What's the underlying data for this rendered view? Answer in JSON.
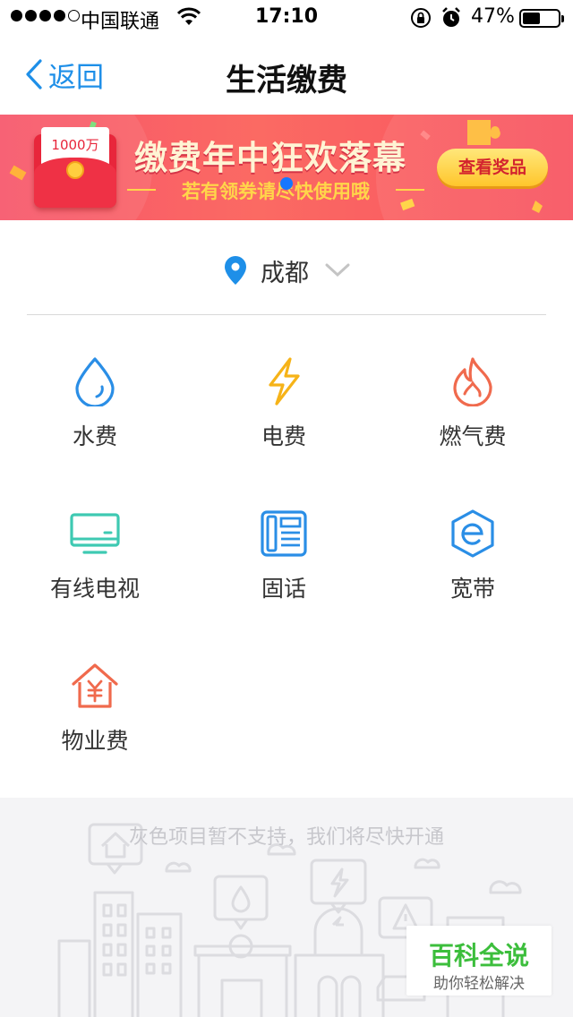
{
  "status_bar": {
    "carrier": "中国联通",
    "time": "17:10",
    "battery_percent": "47%"
  },
  "nav": {
    "back_label": "返回",
    "title": "生活缴费"
  },
  "banner": {
    "envelope_amount": "1000万",
    "headline": "缴费年中狂欢落幕",
    "subline": "若有领券请尽快使用哦",
    "prize_button": "查看奖品"
  },
  "city": {
    "name": "成都"
  },
  "services": [
    {
      "label": "水费",
      "icon": "water-drop-icon",
      "color": "#2a8ee6"
    },
    {
      "label": "电费",
      "icon": "lightning-icon",
      "color": "#f6b318"
    },
    {
      "label": "燃气费",
      "icon": "flame-icon",
      "color": "#f06a4d"
    },
    {
      "label": "有线电视",
      "icon": "tv-icon",
      "color": "#3ec9b2"
    },
    {
      "label": "固话",
      "icon": "landline-phone-icon",
      "color": "#2a8ee6"
    },
    {
      "label": "宽带",
      "icon": "broadband-icon",
      "color": "#2a8ee6"
    },
    {
      "label": "物业费",
      "icon": "property-house-icon",
      "color": "#f06a4d"
    }
  ],
  "footer": {
    "notice": "灰色项目暂不支持，我们将尽快开通"
  },
  "watermark": {
    "title": "百科全说",
    "subtitle": "助你轻松解决"
  }
}
